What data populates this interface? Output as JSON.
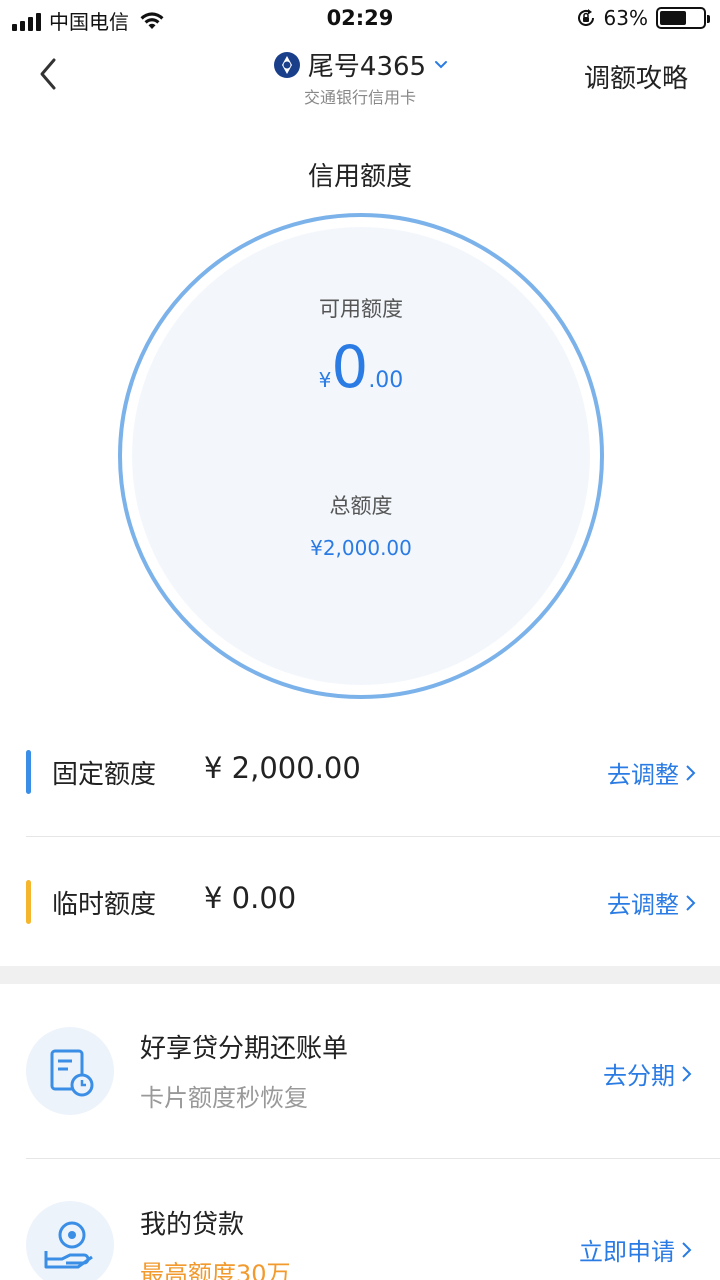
{
  "status_bar": {
    "carrier": "中国电信",
    "time": "02:29",
    "battery_percent": "63%",
    "battery_level": 0.63
  },
  "nav": {
    "title": "尾号4365",
    "subtitle": "交通银行信用卡",
    "right_link": "调额攻略"
  },
  "credit": {
    "section_title": "信用额度",
    "available_label": "可用额度",
    "available_currency": "¥",
    "available_integer": "0",
    "available_decimal": ".00",
    "total_label": "总额度",
    "total_amount": "¥2,000.00"
  },
  "limits": [
    {
      "label": "固定额度",
      "value": "¥ 2,000.00",
      "action": "去调整",
      "bar_color": "#3a8ee6"
    },
    {
      "label": "临时额度",
      "value": "¥ 0.00",
      "action": "去调整",
      "bar_color": "#f5b62e"
    }
  ],
  "promos": [
    {
      "title": "好享贷分期还账单",
      "subtitle": "卡片额度秒恢复",
      "action": "去分期",
      "icon": "bill-clock-icon"
    },
    {
      "title": "我的贷款",
      "subtitle": "最高额度30万",
      "action": "立即申请",
      "icon": "coin-hand-icon"
    }
  ],
  "colors": {
    "accent": "#2a7be3",
    "ring": "#7cb2ea",
    "orange": "#f29a2e"
  }
}
